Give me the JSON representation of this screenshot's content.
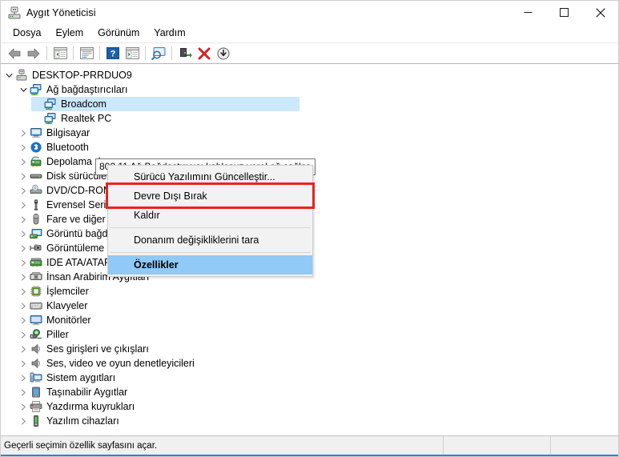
{
  "window": {
    "title": "Aygıt Yöneticisi",
    "icon": "device-manager-icon",
    "caption": {
      "minimize": "minimize-icon",
      "maximize": "maximize-icon",
      "close": "close-icon"
    }
  },
  "menubar": {
    "items": [
      {
        "label": "Dosya"
      },
      {
        "label": "Eylem"
      },
      {
        "label": "Görünüm"
      },
      {
        "label": "Yardım"
      }
    ]
  },
  "toolbar": {
    "buttons": [
      {
        "name": "back-icon"
      },
      {
        "name": "forward-icon"
      },
      {
        "name": "show-hide-console-tree-icon"
      },
      {
        "name": "properties-icon"
      },
      {
        "name": "help-icon"
      },
      {
        "name": "update-driver-icon"
      },
      {
        "name": "scan-hardware-changes-icon"
      },
      {
        "name": "disable-device-icon"
      },
      {
        "name": "uninstall-device-icon"
      },
      {
        "name": "install-legacy-hardware-icon"
      }
    ]
  },
  "tree": {
    "root": {
      "label": "DESKTOP-PRRDUO9",
      "icon": "computer-root-icon",
      "expanded": true
    },
    "nodes": [
      {
        "label": "Ağ bağdaştırıcıları",
        "icon": "network-adapter-icon",
        "level": 1,
        "state": "expanded",
        "selected": false
      },
      {
        "label": "Broadcom",
        "icon": "network-adapter-icon",
        "level": 2,
        "state": "leaf",
        "selected": true
      },
      {
        "label": "Realtek PC",
        "icon": "network-adapter-icon",
        "level": 2,
        "state": "leaf",
        "selected": false
      },
      {
        "label": "Bilgisayar",
        "icon": "computer-icon",
        "level": 1,
        "state": "collapsed",
        "selected": false
      },
      {
        "label": "Bluetooth",
        "icon": "bluetooth-icon",
        "level": 1,
        "state": "collapsed",
        "selected": false
      },
      {
        "label": "Depolama der",
        "icon": "storage-controller-icon",
        "level": 1,
        "state": "collapsed",
        "selected": false
      },
      {
        "label": "Disk sürücüler",
        "icon": "disk-drive-icon",
        "level": 1,
        "state": "collapsed",
        "selected": false
      },
      {
        "label": "DVD/CD-ROM",
        "icon": "dvd-drive-icon",
        "level": 1,
        "state": "collapsed",
        "selected": false
      },
      {
        "label": "Evrensel Seri V",
        "icon": "usb-icon",
        "level": 1,
        "state": "collapsed",
        "selected": false
      },
      {
        "label": "Fare ve diğer işaret aygıtları",
        "icon": "mouse-icon",
        "level": 1,
        "state": "collapsed",
        "selected": false
      },
      {
        "label": "Görüntü bağdaştırıcıları",
        "icon": "display-adapter-icon",
        "level": 1,
        "state": "collapsed",
        "selected": false
      },
      {
        "label": "Görüntüleme aygıtları",
        "icon": "imaging-device-icon",
        "level": 1,
        "state": "collapsed",
        "selected": false
      },
      {
        "label": "IDE ATA/ATAPI denetleyiciler",
        "icon": "ide-controller-icon",
        "level": 1,
        "state": "collapsed",
        "selected": false
      },
      {
        "label": "İnsan Arabirim Aygıtları",
        "icon": "hid-icon",
        "level": 1,
        "state": "collapsed",
        "selected": false
      },
      {
        "label": "İşlemciler",
        "icon": "processor-icon",
        "level": 1,
        "state": "collapsed",
        "selected": false
      },
      {
        "label": "Klavyeler",
        "icon": "keyboard-icon",
        "level": 1,
        "state": "collapsed",
        "selected": false
      },
      {
        "label": "Monitörler",
        "icon": "monitor-icon",
        "level": 1,
        "state": "collapsed",
        "selected": false
      },
      {
        "label": "Piller",
        "icon": "battery-icon",
        "level": 1,
        "state": "collapsed",
        "selected": false
      },
      {
        "label": "Ses girişleri ve çıkışları",
        "icon": "audio-io-icon",
        "level": 1,
        "state": "collapsed",
        "selected": false
      },
      {
        "label": "Ses, video ve oyun denetleyicileri",
        "icon": "audio-video-game-icon",
        "level": 1,
        "state": "collapsed",
        "selected": false
      },
      {
        "label": "Sistem aygıtları",
        "icon": "system-device-icon",
        "level": 1,
        "state": "collapsed",
        "selected": false
      },
      {
        "label": "Taşınabilir Aygıtlar",
        "icon": "portable-device-icon",
        "level": 1,
        "state": "collapsed",
        "selected": false
      },
      {
        "label": "Yazdırma kuyrukları",
        "icon": "print-queue-icon",
        "level": 1,
        "state": "collapsed",
        "selected": false
      },
      {
        "label": "Yazılım cihazları",
        "icon": "software-device-icon",
        "level": 1,
        "state": "collapsed",
        "selected": false
      }
    ]
  },
  "tooltip": {
    "text": "802.11 Ağ Bağdaştırıcısı kablosuz yerel ağ sağlar."
  },
  "context_menu": {
    "items": [
      {
        "label": "Sürücü Yazılımını Güncelleştir...",
        "highlighted": false,
        "separator_after": false
      },
      {
        "label": "Devre Dışı Bırak",
        "highlighted": false,
        "separator_after": false
      },
      {
        "label": "Kaldır",
        "highlighted": false,
        "separator_after": true
      },
      {
        "label": "Donanım değişikliklerini tara",
        "highlighted": false,
        "separator_after": true
      },
      {
        "label": "Özellikler",
        "highlighted": true,
        "separator_after": false
      }
    ]
  },
  "annotation": {
    "color": "#e8231f",
    "target": "Özellikler"
  },
  "statusbar": {
    "message": "Geçerli seçimin özellik sayfasını açar.",
    "pane2": "",
    "pane3": ""
  },
  "colors": {
    "selection": "#cce8ff",
    "menu_highlight": "#91c9f7",
    "annotation": "#e8231f",
    "status_underline": "#2b84d6"
  }
}
